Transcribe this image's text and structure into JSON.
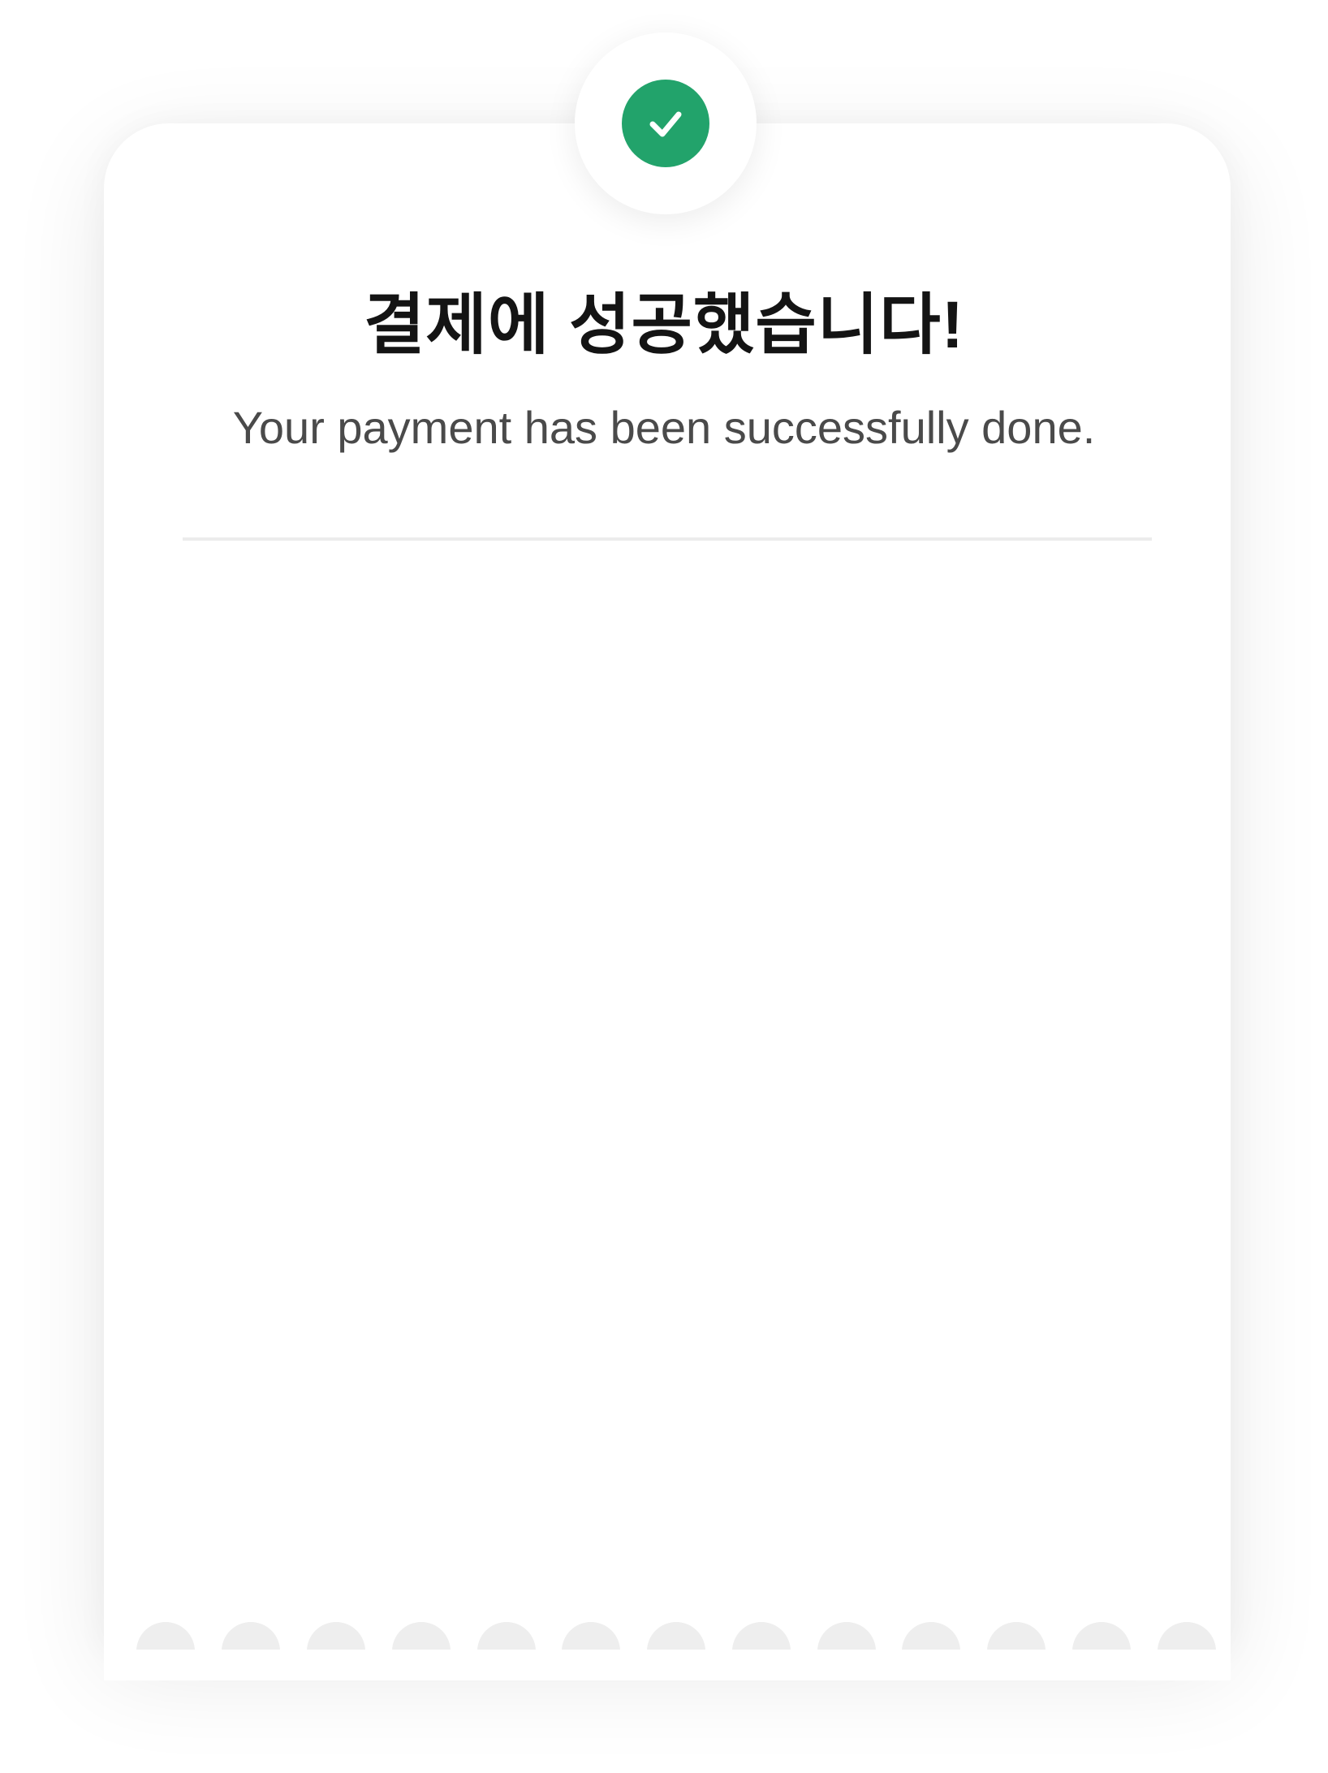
{
  "header": {
    "title": "결제에 성공했습니다!",
    "subtitle": "Your payment has been successfully done."
  },
  "status": {
    "icon": "check-icon",
    "accent_color": "#22a36b"
  }
}
